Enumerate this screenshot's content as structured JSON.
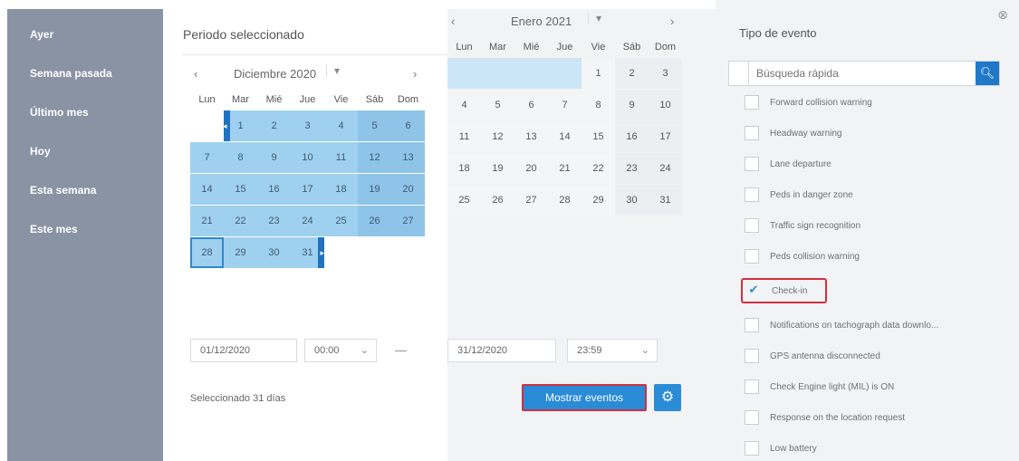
{
  "sidebar": {
    "presets": [
      "Ayer",
      "Semana pasada",
      "Último mes",
      "Hoy",
      "Esta semana",
      "Este mes"
    ]
  },
  "period": {
    "title": "Periodo seleccionado",
    "left_month": "Diciembre 2020",
    "right_month": "Enero 2021",
    "weekdays": [
      "Lun",
      "Mar",
      "Mié",
      "Jue",
      "Vie",
      "Sáb",
      "Dom"
    ],
    "left_weeks": [
      [
        "",
        "1",
        "2",
        "3",
        "4",
        "5",
        "6"
      ],
      [
        "7",
        "8",
        "9",
        "10",
        "11",
        "12",
        "13"
      ],
      [
        "14",
        "15",
        "16",
        "17",
        "18",
        "19",
        "20"
      ],
      [
        "21",
        "22",
        "23",
        "24",
        "25",
        "26",
        "27"
      ],
      [
        "28",
        "29",
        "30",
        "31",
        "",
        "",
        ""
      ]
    ],
    "right_weeks": [
      [
        "",
        "",
        "",
        "",
        "1",
        "2",
        "3"
      ],
      [
        "4",
        "5",
        "6",
        "7",
        "8",
        "9",
        "10"
      ],
      [
        "11",
        "12",
        "13",
        "14",
        "15",
        "16",
        "17"
      ],
      [
        "18",
        "19",
        "20",
        "21",
        "22",
        "23",
        "24"
      ],
      [
        "25",
        "26",
        "27",
        "28",
        "29",
        "30",
        "31"
      ]
    ],
    "start_date": "01/12/2020",
    "start_time": "00:00",
    "dash": "—",
    "end_date": "31/12/2020",
    "end_time": "23:59",
    "selected_text": "Seleccionado 31 días",
    "show_button": "Mostrar eventos"
  },
  "events_panel": {
    "title": "Tipo de evento",
    "search_placeholder": "Búsqueda rápida",
    "items": [
      {
        "label": "Forward collision warning",
        "checked": false
      },
      {
        "label": "Headway warning",
        "checked": false
      },
      {
        "label": "Lane departure",
        "checked": false
      },
      {
        "label": "Peds in danger zone",
        "checked": false
      },
      {
        "label": "Traffic sign recognition",
        "checked": false
      },
      {
        "label": "Peds collision warning",
        "checked": false
      },
      {
        "label": "Check-in",
        "checked": true
      },
      {
        "label": "Notifications on tachograph data downlo...",
        "checked": false
      },
      {
        "label": "GPS antenna disconnected",
        "checked": false
      },
      {
        "label": "Check Engine light (MIL) is ON",
        "checked": false
      },
      {
        "label": "Response on the location request",
        "checked": false
      },
      {
        "label": "Low battery",
        "checked": false
      }
    ]
  },
  "colors": {
    "sidebar": "#8a93a3",
    "selection": "#9fd0ef",
    "accent": "#2a8bd6",
    "highlight_border": "#d32f3e"
  }
}
